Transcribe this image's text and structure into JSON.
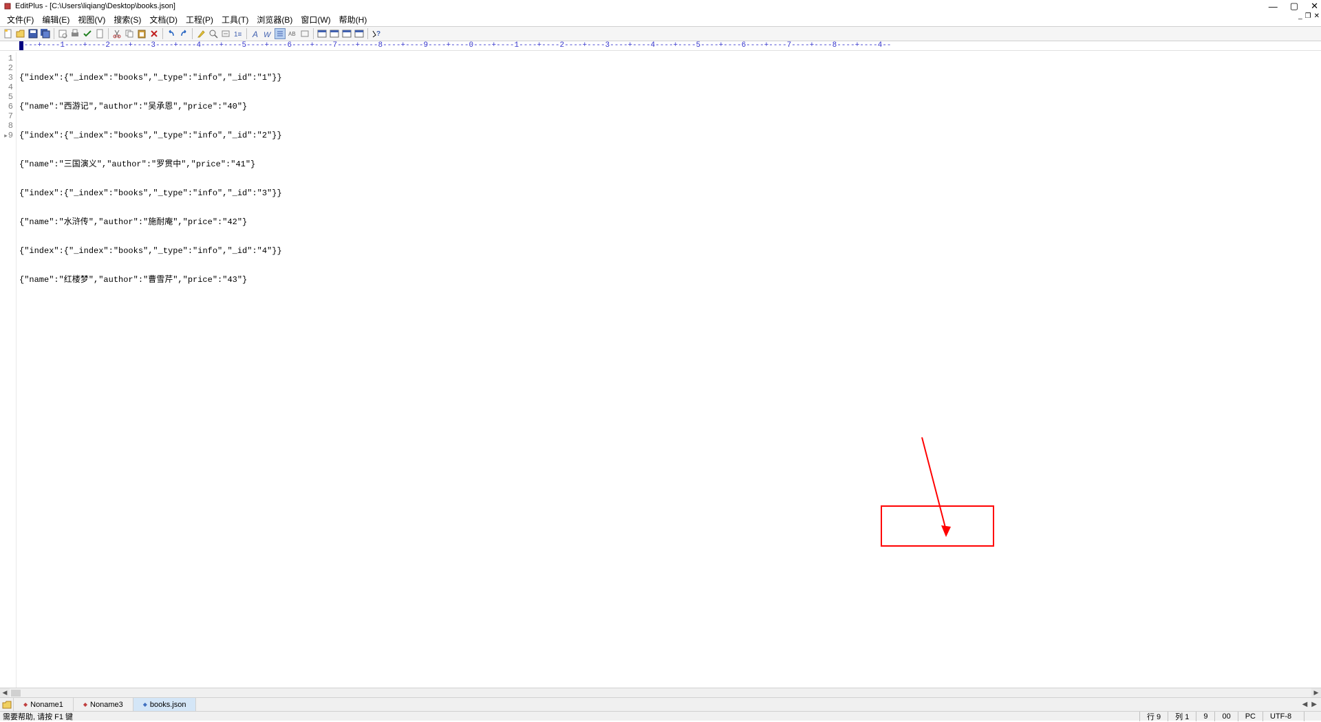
{
  "title": "EditPlus - [C:\\Users\\liqiang\\Desktop\\books.json]",
  "menus": [
    "文件(F)",
    "编辑(E)",
    "视图(V)",
    "搜索(S)",
    "文档(D)",
    "工程(P)",
    "工具(T)",
    "浏览器(B)",
    "窗口(W)",
    "帮助(H)"
  ],
  "ruler_text": "----+----1----+----2----+----3----+----4----+----5----+----6----+----7----+----8----+----9----+----0----+----1----+----2----+----3----+----4----+----5----+----6----+----7----+----8----+----4--",
  "lines": [
    "{\"index\":{\"_index\":\"books\",\"_type\":\"info\",\"_id\":\"1\"}}",
    "{\"name\":\"西游记\",\"author\":\"吴承恩\",\"price\":\"40\"}",
    "{\"index\":{\"_index\":\"books\",\"_type\":\"info\",\"_id\":\"2\"}}",
    "{\"name\":\"三国演义\",\"author\":\"罗贯中\",\"price\":\"41\"}",
    "{\"index\":{\"_index\":\"books\",\"_type\":\"info\",\"_id\":\"3\"}}",
    "{\"name\":\"水浒传\",\"author\":\"施耐庵\",\"price\":\"42\"}",
    "{\"index\":{\"_index\":\"books\",\"_type\":\"info\",\"_id\":\"4\"}}",
    "{\"name\":\"红楼梦\",\"author\":\"曹雪芹\",\"price\":\"43\"}"
  ],
  "line_numbers": [
    "1",
    "2",
    "3",
    "4",
    "5",
    "6",
    "7",
    "8",
    "9"
  ],
  "tabs": [
    {
      "label": "Noname1",
      "modified": true,
      "active": false
    },
    {
      "label": "Noname3",
      "modified": true,
      "active": false
    },
    {
      "label": "books.json",
      "modified": false,
      "active": true
    }
  ],
  "status": {
    "help": "需要帮助, 请按 F1 键",
    "row_label": "行 9",
    "col_label": "列 1",
    "count": "9",
    "code": "00",
    "mode": "PC",
    "encoding": "UTF-8"
  }
}
